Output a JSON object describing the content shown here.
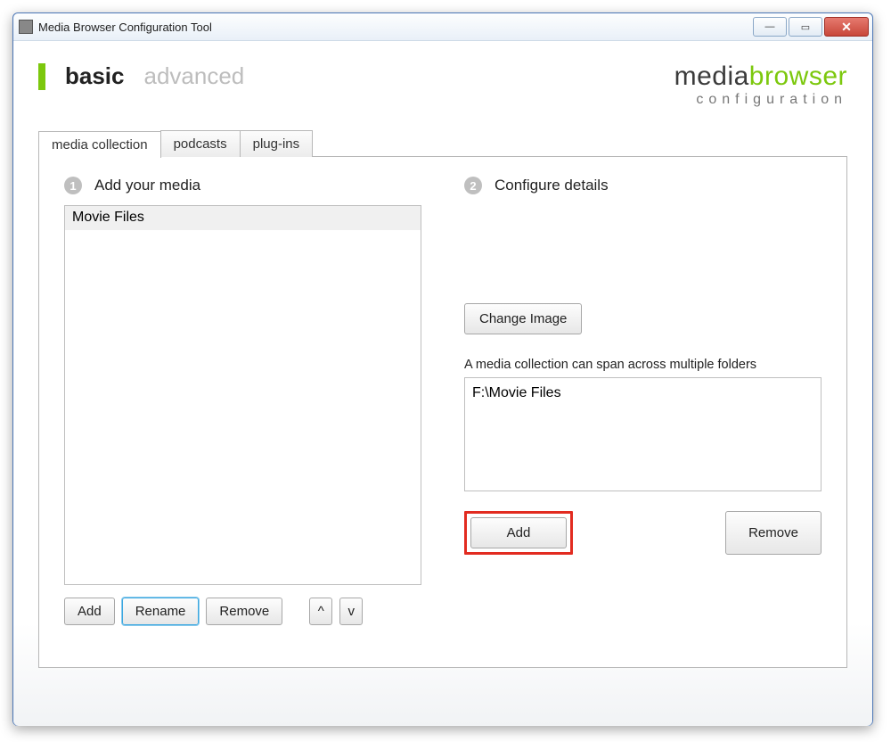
{
  "window": {
    "title": "Media Browser Configuration Tool"
  },
  "modes": {
    "basic": "basic",
    "advanced": "advanced"
  },
  "brand": {
    "part1": "media",
    "part2": "browser",
    "sub": "configuration"
  },
  "tabs": {
    "media_collection": "media collection",
    "podcasts": "podcasts",
    "plugins": "plug-ins"
  },
  "left": {
    "step_num": "1",
    "step_title": "Add your media",
    "items": [
      "Movie Files"
    ],
    "buttons": {
      "add": "Add",
      "rename": "Rename",
      "remove": "Remove",
      "up": "^",
      "down": "v"
    }
  },
  "right": {
    "step_num": "2",
    "step_title": "Configure details",
    "change_image": "Change Image",
    "hint": "A media collection can span across multiple folders",
    "folders": [
      "F:\\Movie Files"
    ],
    "add": "Add",
    "remove": "Remove"
  }
}
